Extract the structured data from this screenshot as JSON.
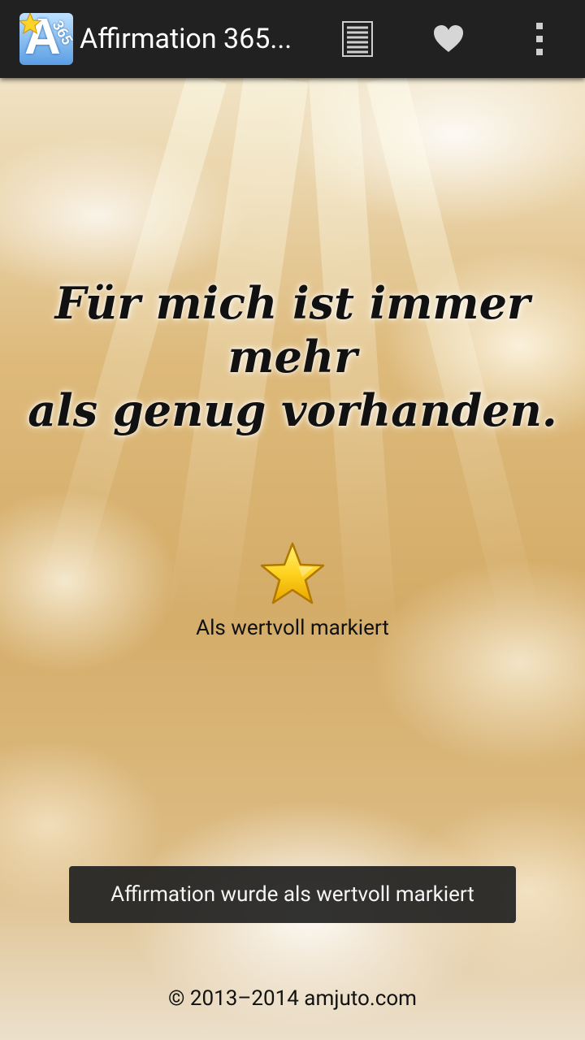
{
  "app": {
    "title": "Affirmation 365...",
    "icon_badge": "365"
  },
  "toolbar": {
    "list_icon": "list-icon",
    "favorites_icon": "heart-icon",
    "overflow_icon": "overflow-menu-icon"
  },
  "main": {
    "affirmation_line1": "Für mich ist immer mehr",
    "affirmation_line2": "als genug vorhanden.",
    "favorite_status_label": "Als wertvoll markiert",
    "favorite_icon": "star-icon"
  },
  "toast": {
    "message": "Affirmation wurde als wertvoll markiert"
  },
  "footer": {
    "copyright": "© 2013–2014 amjuto.com"
  },
  "colors": {
    "actionbar": "#212121",
    "star": "#f5c518",
    "toast_bg": "#212121"
  }
}
